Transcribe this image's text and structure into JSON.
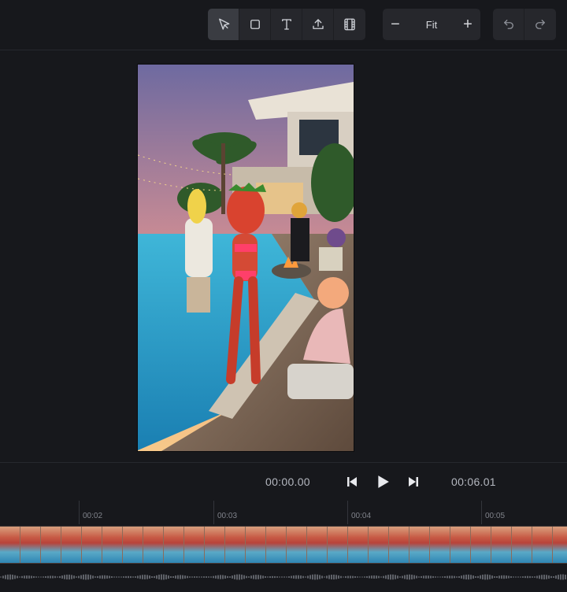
{
  "toolbar": {
    "tools": [
      {
        "name": "select-tool",
        "icon": "cursor-icon",
        "active": true
      },
      {
        "name": "shape-tool",
        "icon": "square-icon",
        "active": false
      },
      {
        "name": "text-tool",
        "icon": "text-icon",
        "active": false
      },
      {
        "name": "upload-tool",
        "icon": "upload-icon",
        "active": false
      },
      {
        "name": "media-tool",
        "icon": "film-icon",
        "active": false
      }
    ],
    "zoom": {
      "minus": "−",
      "label": "Fit",
      "plus": "+"
    },
    "history": {
      "undo_icon": "undo-icon",
      "redo_icon": "redo-icon"
    }
  },
  "playback": {
    "current_time": "00:00.00",
    "total_time": "00:06.01"
  },
  "timeline": {
    "ticks": [
      "00:02",
      "00:03",
      "00:04",
      "00:05"
    ]
  },
  "colors": {
    "background": "#17181c",
    "panel": "#26272c",
    "active_tool": "#3a3c42"
  }
}
